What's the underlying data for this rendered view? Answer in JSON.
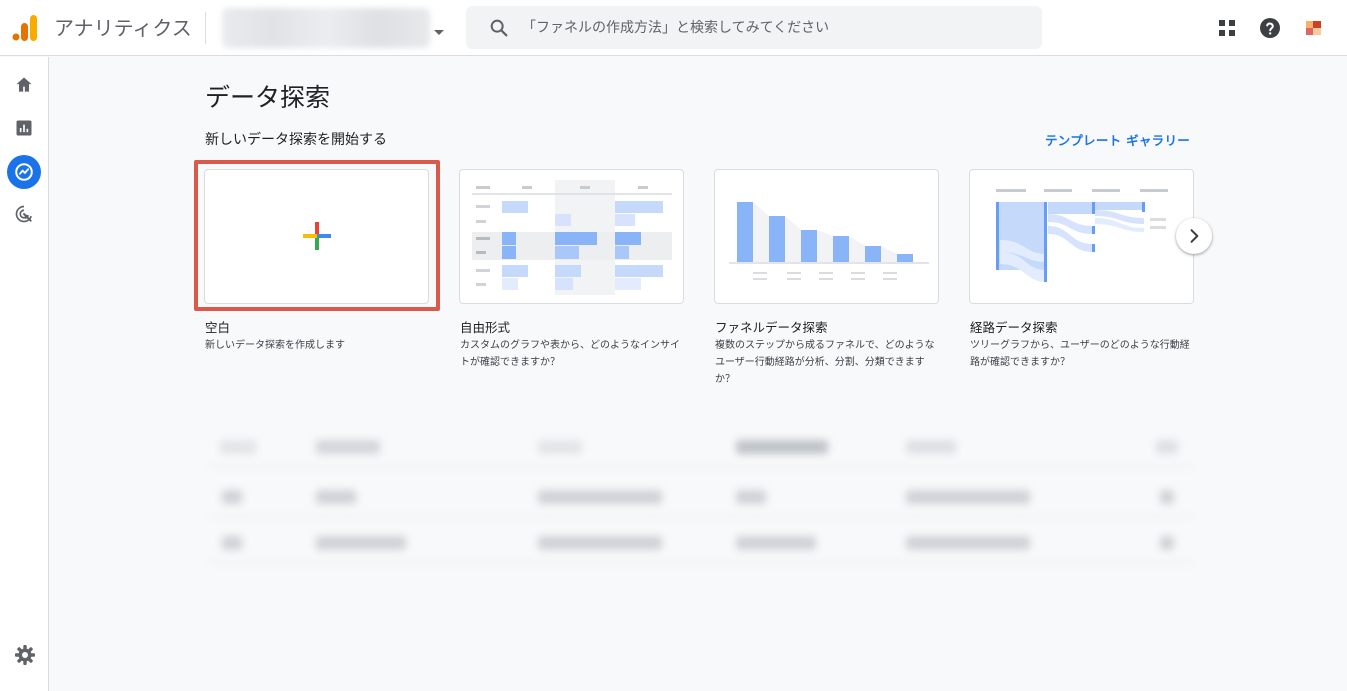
{
  "app": {
    "title": "アナリティクス"
  },
  "search": {
    "placeholder": "「ファネルの作成方法」と検索してみてください"
  },
  "header": {
    "page_title": "データ探索"
  },
  "section": {
    "title": "新しいデータ探索を開始する",
    "gallery_link": "テンプレート ギャラリー"
  },
  "templates": [
    {
      "label": "空白",
      "description": "新しいデータ探索を作成します"
    },
    {
      "label": "自由形式",
      "description": "カスタムのグラフや表から、どのようなインサイトが確認できますか？"
    },
    {
      "label": "ファネルデータ探索",
      "description": "複数のステップから成るファネルで、どのようなユーザー行動経路が分析、分割、分類できますか？"
    },
    {
      "label": "経路データ探索",
      "description": "ツリーグラフから、ユーザーのどのような行動経路が確認できますか？"
    }
  ],
  "icons": {
    "topbar": [
      "analytics-logo",
      "search-icon",
      "apps-grid-icon",
      "help-icon",
      "account-avatar"
    ],
    "rail": [
      "home-icon",
      "reports-icon",
      "explore-icon",
      "advertising-icon",
      "settings-icon"
    ],
    "nav": "chevron-right-icon"
  },
  "colors": {
    "accent": "#1a73e8",
    "highlight": "#d9594a",
    "logo_orange": "#f9ab00",
    "logo_dark_orange": "#e37400"
  }
}
